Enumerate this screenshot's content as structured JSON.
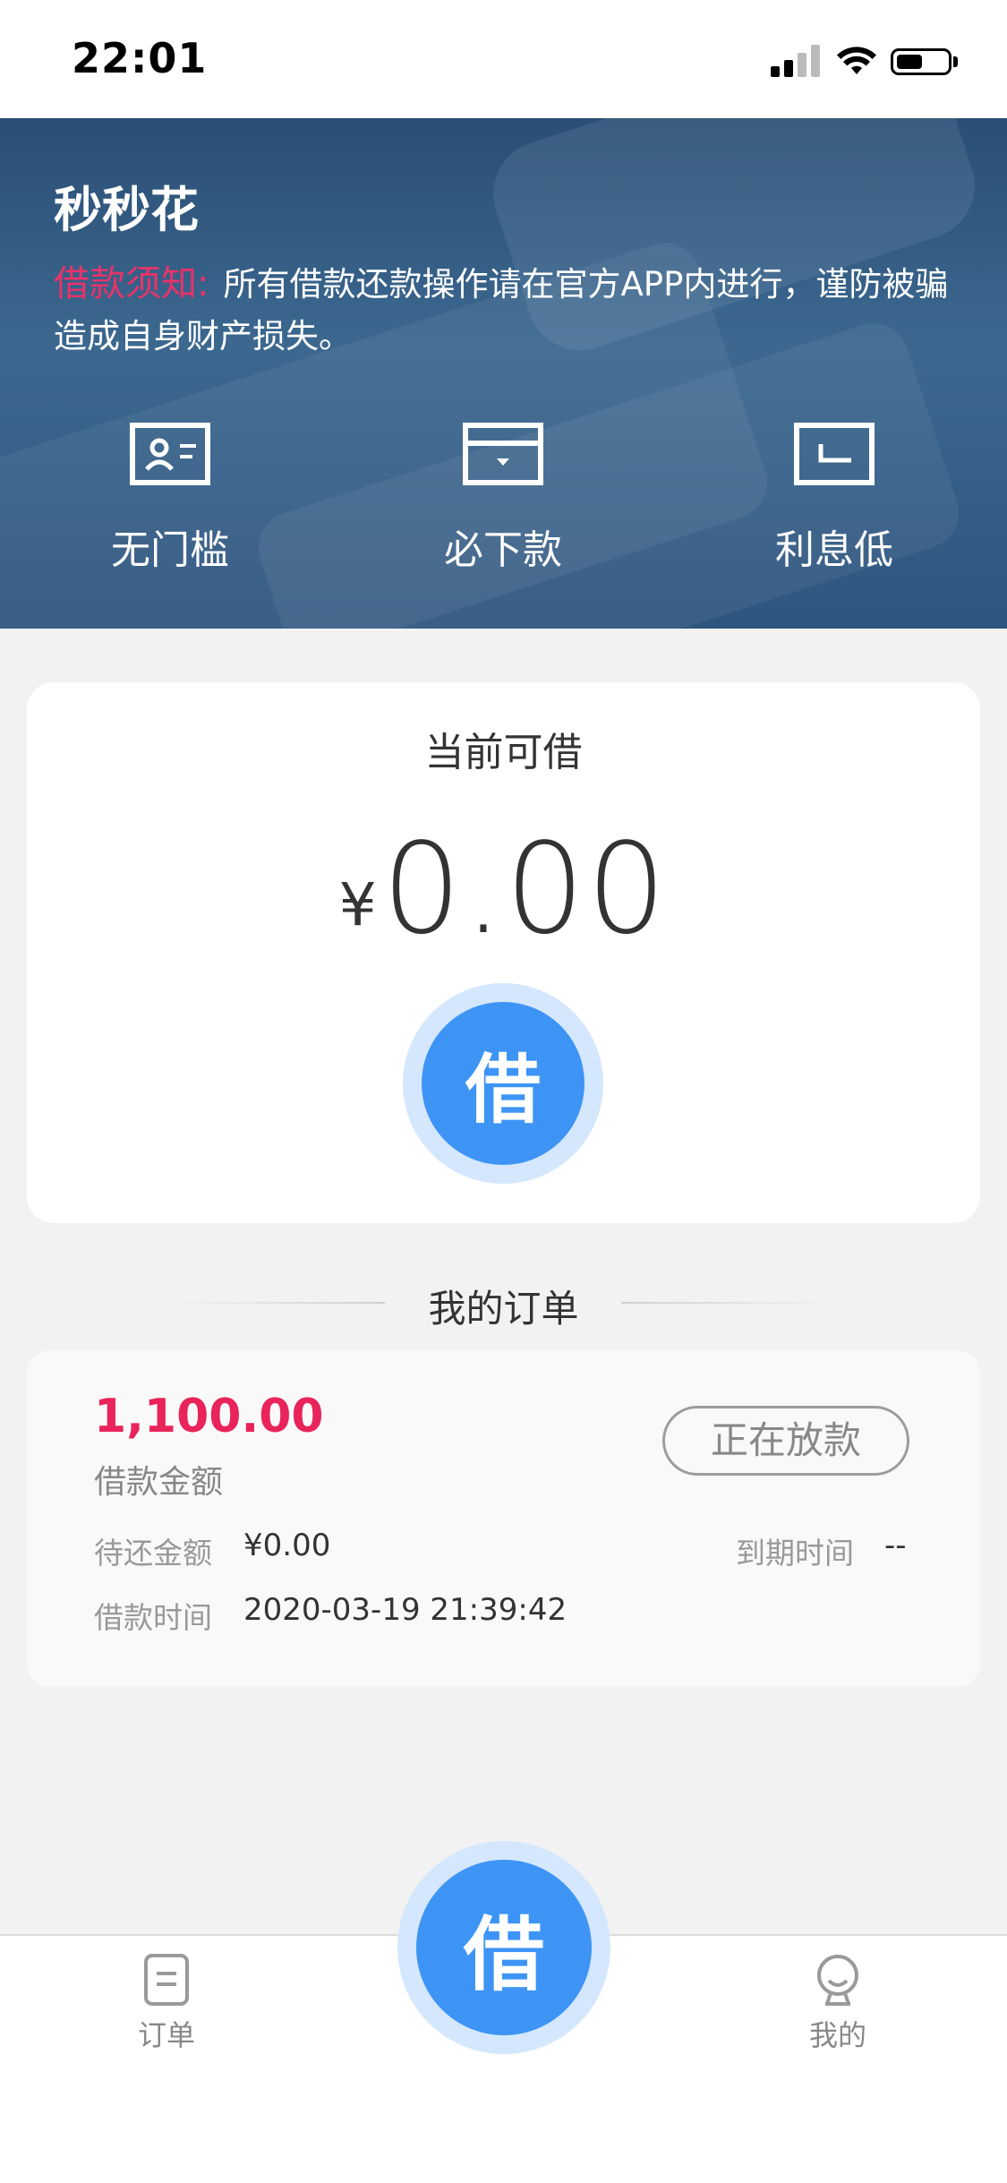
{
  "status_bar": {
    "time": "22:01",
    "signal_icon": "cellular-signal-icon",
    "wifi_icon": "wifi-icon",
    "battery_icon": "battery-icon",
    "battery_level": 0.5
  },
  "banner": {
    "app_title": "秒秒花",
    "notice_label": "借款须知:",
    "notice_text": "所有借款还款操作请在官方APP内进行，谨防被骗造成自身财产损失。",
    "features": [
      {
        "icon": "id-card-icon",
        "label": "无门槛"
      },
      {
        "icon": "wallet-icon",
        "label": "必下款"
      },
      {
        "icon": "return-card-icon",
        "label": "利息低"
      }
    ]
  },
  "loan_card": {
    "title": "当前可借",
    "currency": "¥",
    "amount": "0.00",
    "borrow_button": "借"
  },
  "orders_section": {
    "title": "我的订单"
  },
  "order": {
    "amount": "1,100.00",
    "amount_label": "借款金额",
    "status": "正在放款",
    "pending_label": "待还金额",
    "pending_value": "¥0.00",
    "due_label": "到期时间",
    "due_value": "--",
    "loan_time_label": "借款时间",
    "loan_time_value": "2020-03-19 21:39:42"
  },
  "tabbar": {
    "orders_label": "订单",
    "orders_icon": "document-icon",
    "center_button": "借",
    "mine_label": "我的",
    "mine_icon": "user-icon"
  },
  "colors": {
    "accent_blue": "#3d94f5",
    "accent_blue_light": "#d4e7fd",
    "notice_red": "#e8336a",
    "amount_red": "#e8245a",
    "banner_blue": "#2e557e",
    "page_bg": "#f2f2f2"
  }
}
